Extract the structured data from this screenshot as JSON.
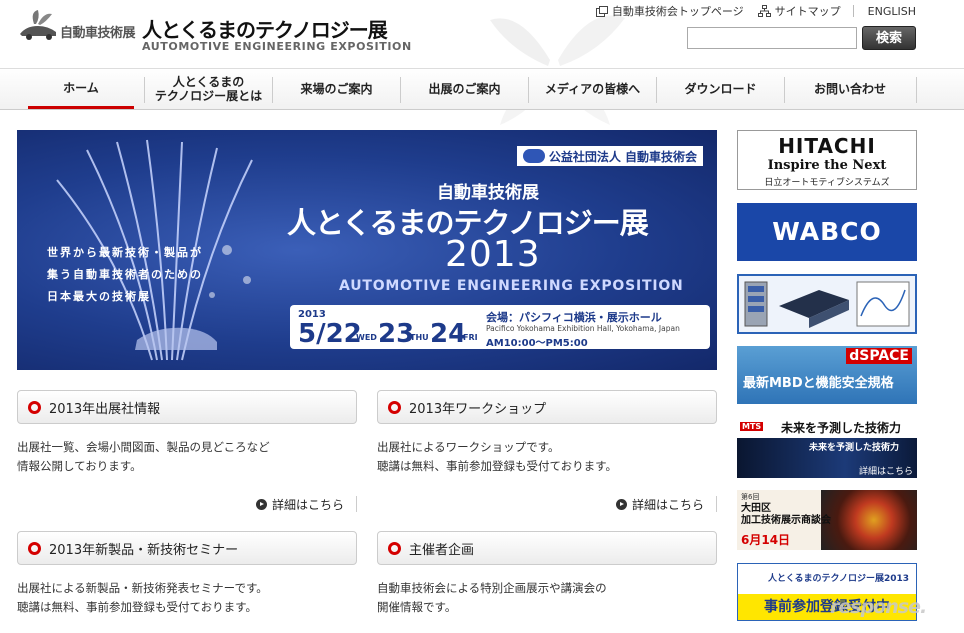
{
  "header": {
    "logo_small": "自動車技術展",
    "logo_main": "人とくるまのテクノロジー展",
    "logo_en": "AUTOMOTIVE ENGINEERING EXPOSITION",
    "links": {
      "top_page": "自動車技術会トップページ",
      "sitemap": "サイトマップ",
      "english": "ENGLISH"
    },
    "search": {
      "placeholder": "",
      "button": "検索"
    }
  },
  "nav": {
    "items": [
      {
        "label": "ホーム"
      },
      {
        "label": "人とくるまの\nテクノロジー展とは"
      },
      {
        "label": "来場のご案内"
      },
      {
        "label": "出展のご案内"
      },
      {
        "label": "メディアの皆様へ"
      },
      {
        "label": "ダウンロード"
      },
      {
        "label": "お問い合わせ"
      }
    ]
  },
  "hero": {
    "org": "公益社団法人 自動車技術会",
    "small_title": "自動車技術展",
    "title": "人とくるまのテクノロジー展",
    "year": "2013",
    "en_title": "AUTOMOTIVE ENGINEERING EXPOSITION",
    "tagline": "世界から最新技術・製品が\n集う自動車技術者のための\n日本最大の技術展",
    "date": {
      "year": "2013",
      "month_day1": "5/22",
      "dow1": "WED",
      "day2": "23",
      "dow2": "THU",
      "day3": "24",
      "dow3": "FRI"
    },
    "venue": "会場：パシフィコ横浜・展示ホール",
    "venue_en": "Pacifico Yokohama Exhibition Hall, Yokohama, Japan",
    "time": "AM10:00〜PM5:00"
  },
  "boxes": [
    {
      "title": "2013年出展社情報",
      "text": "出展社一覧、会場小間図面、製品の見どころなど\n情報公開しております。",
      "more": "詳細はこちら"
    },
    {
      "title": "2013年ワークショップ",
      "text": "出展社によるワークショップです。\n聴講は無料、事前参加登録も受付ております。",
      "more": "詳細はこちら"
    },
    {
      "title": "2013年新製品・新技術セミナー",
      "text": "出展社による新製品・新技術発表セミナーです。\n聴講は無料、事前参加登録も受付ております。"
    },
    {
      "title": "主催者企画",
      "text": "自動車技術会による特別企画展示や講演会の\n開催情報です。"
    }
  ],
  "ads": {
    "hitachi": {
      "name": "HITACHI",
      "slogan": "Inspire the Next",
      "division": "日立オートモティブシステムズ"
    },
    "wabco": {
      "name": "WABCO"
    },
    "dspace": {
      "name": "dSPACE",
      "text": "最新MBDと機能安全規格"
    },
    "mts": {
      "logo": "MTS",
      "headline": "未来を予測した技術力",
      "band": "未来を予測した技術力",
      "more": "詳細はこちら"
    },
    "ota": {
      "small": "第6回",
      "title": "大田区\n加工技術展示商談会",
      "date": "6月14日"
    },
    "reg": {
      "title": "人とくるまのテクノロジー展2013",
      "cta": "事前参加登録受付中"
    }
  },
  "watermark": "response."
}
